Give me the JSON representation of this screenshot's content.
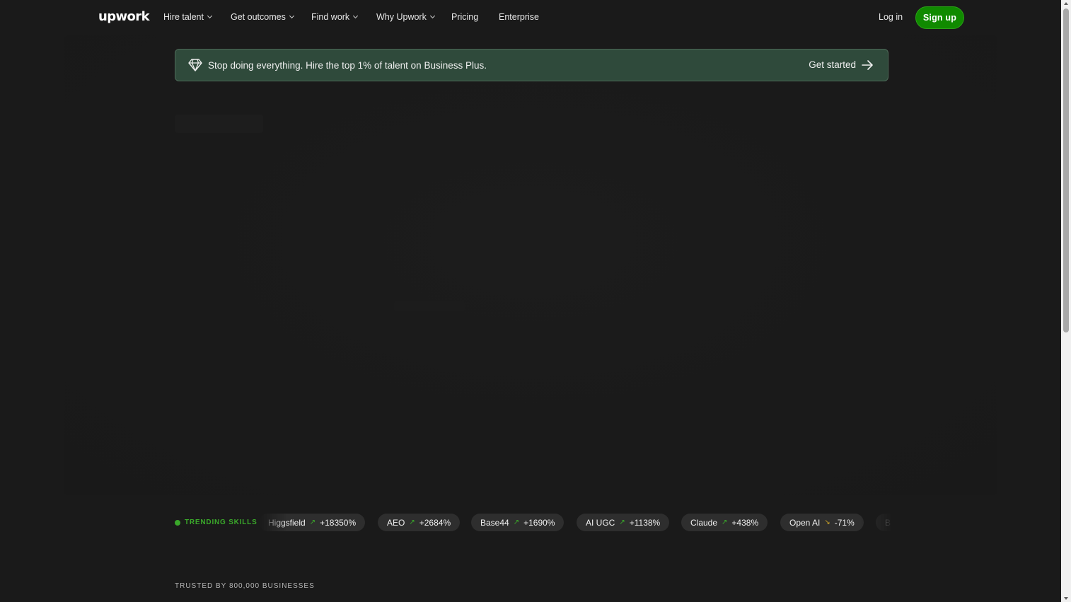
{
  "nav": {
    "logo": "upwork",
    "items": [
      {
        "label": "Hire talent",
        "dropdown": true
      },
      {
        "label": "Get outcomes",
        "dropdown": true
      },
      {
        "label": "Find work",
        "dropdown": true
      },
      {
        "label": "Why Upwork",
        "dropdown": true
      },
      {
        "label": "Pricing",
        "dropdown": false
      },
      {
        "label": "Enterprise",
        "dropdown": false
      }
    ],
    "login": "Log in",
    "signup": "Sign up"
  },
  "banner": {
    "icon": "diamond-icon",
    "text": "Stop doing everything. Hire the top 1% of talent on Business Plus.",
    "cta": "Get started",
    "cta_icon": "arrow-right-icon"
  },
  "trending": {
    "label": "TRENDING SKILLS",
    "skills": [
      {
        "name": "Higgsfield",
        "change": "+18350%",
        "direction": "up"
      },
      {
        "name": "AEO",
        "change": "+2684%",
        "direction": "up"
      },
      {
        "name": "Base44",
        "change": "+1690%",
        "direction": "up"
      },
      {
        "name": "AI UGC",
        "change": "+1138%",
        "direction": "up"
      },
      {
        "name": "Claude",
        "change": "+438%",
        "direction": "up"
      },
      {
        "name": "Open AI",
        "change": "-71%",
        "direction": "down"
      },
      {
        "name": "B",
        "change": "",
        "direction": "up"
      }
    ]
  },
  "trusted": {
    "text": "TRUSTED BY 800,000 BUSINESSES"
  },
  "colors": {
    "background": "#1a1a1a",
    "brand_green": "#108a00",
    "trend_green": "#3aa82a",
    "trend_down": "#c9a227",
    "banner_bg": "#2f4a3b",
    "pill_bg": "#2e2e2e"
  }
}
